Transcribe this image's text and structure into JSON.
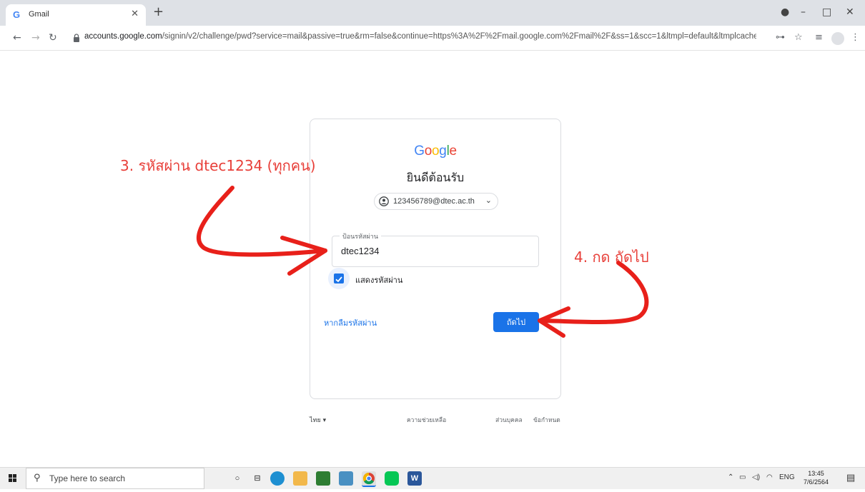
{
  "browser": {
    "tab_title": "Gmail",
    "tab_favicon": "G",
    "new_tab_label": "+",
    "url_host": "accounts.google.com",
    "url_path": "/signin/v2/challenge/pwd?service=mail&passive=true&rm=false&continue=https%3A%2F%2Fmail.google.com%2Fmail%2F&ss=1&scc=1&ltmpl=default&ltmplcache=2&e..."
  },
  "signin": {
    "logo": "Google",
    "title": "ยินดีต้อนรับ",
    "account_email": "123456789@dtec.ac.th",
    "password_label": "ป้อนรหัสผ่าน",
    "password_value": "dtec1234",
    "show_password_label": "แสดงรหัสผ่าน",
    "show_password_checked": true,
    "forgot_password_link": "หากลืมรหัสผ่าน",
    "next_button": "ถัดไป"
  },
  "footer": {
    "language": "ไทย",
    "links": [
      "ความช่วยเหลือ",
      "ส่วนบุคคล",
      "ข้อกำหนด"
    ]
  },
  "annotations": {
    "step3": "3. รหัสผ่าน dtec1234 (ทุกคน)",
    "step4": "4. กด ถัดไป",
    "color": "#e8403a"
  },
  "taskbar": {
    "search_placeholder": "Type here to search",
    "apps": [
      "W"
    ],
    "tray_lang": "ENG",
    "time": "13:45",
    "date": "7/6/2564"
  },
  "colors": {
    "primary": "#1a73e8",
    "tabbar": "#dee1e6"
  }
}
